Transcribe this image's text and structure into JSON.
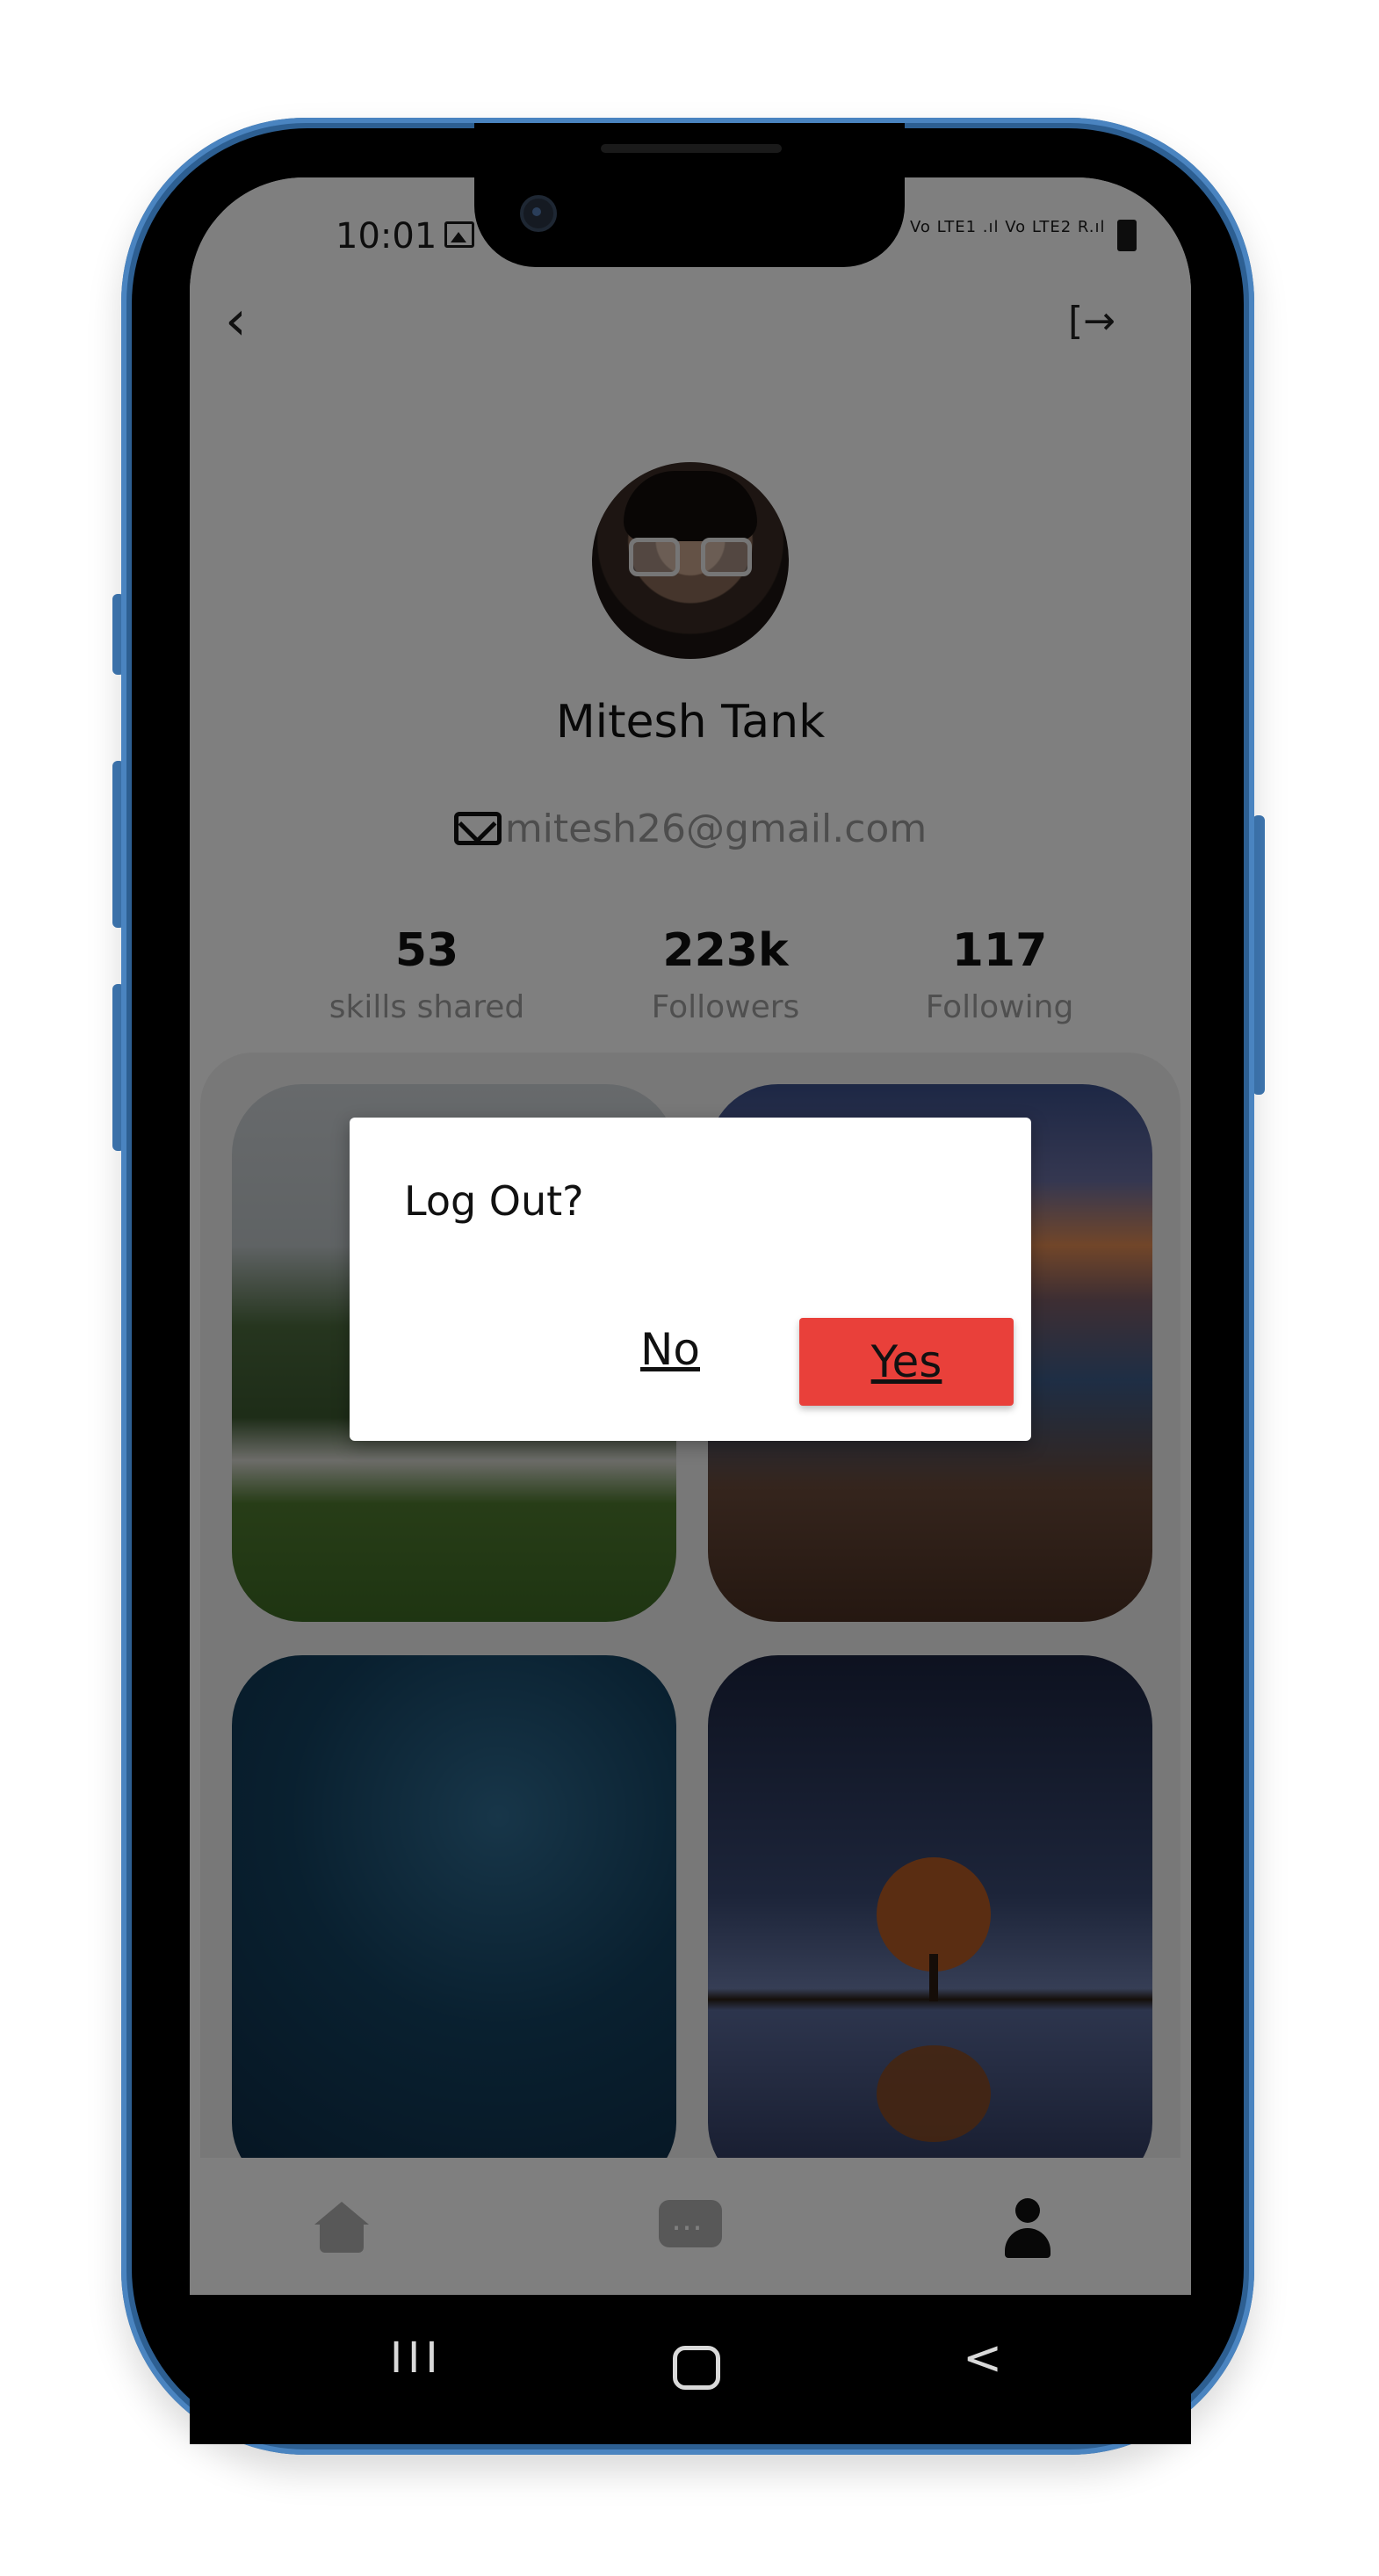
{
  "status_bar": {
    "time": "10:01",
    "signal_text": "Vo LTE1 .ıl Vo LTE2 R.ıl"
  },
  "profile": {
    "name": "Mitesh Tank",
    "email": "mitesh26@gmail.com",
    "stats": [
      {
        "value": "53",
        "label": "skills shared"
      },
      {
        "value": "223k",
        "label": "Followers"
      },
      {
        "value": "117",
        "label": "Following"
      }
    ]
  },
  "dialog": {
    "title": "Log Out?",
    "no_label": "No",
    "yes_label": "Yes",
    "yes_color": "#e9403a"
  },
  "icons": {
    "back": "chevron-left-icon",
    "logout": "logout-icon",
    "email": "mail-icon",
    "home": "home-icon",
    "chat": "chat-icon",
    "profile": "person-icon"
  },
  "system_nav": {
    "recent": "III",
    "back": "<"
  }
}
